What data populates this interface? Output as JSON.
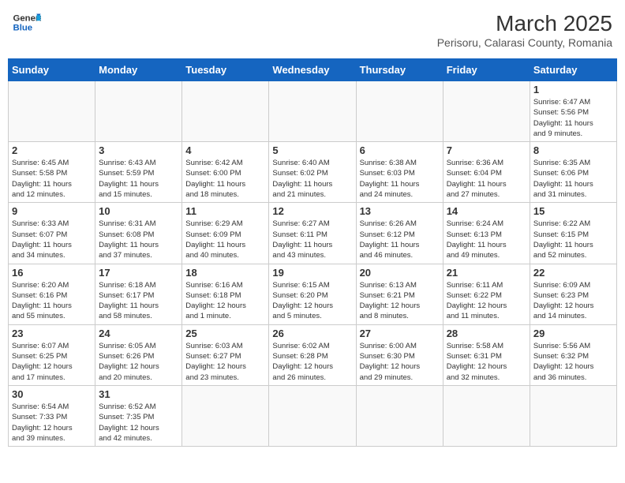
{
  "header": {
    "logo_general": "General",
    "logo_blue": "Blue",
    "month_year": "March 2025",
    "location": "Perisoru, Calarasi County, Romania"
  },
  "weekdays": [
    "Sunday",
    "Monday",
    "Tuesday",
    "Wednesday",
    "Thursday",
    "Friday",
    "Saturday"
  ],
  "weeks": [
    [
      {
        "day": "",
        "info": ""
      },
      {
        "day": "",
        "info": ""
      },
      {
        "day": "",
        "info": ""
      },
      {
        "day": "",
        "info": ""
      },
      {
        "day": "",
        "info": ""
      },
      {
        "day": "",
        "info": ""
      },
      {
        "day": "1",
        "info": "Sunrise: 6:47 AM\nSunset: 5:56 PM\nDaylight: 11 hours\nand 9 minutes."
      }
    ],
    [
      {
        "day": "2",
        "info": "Sunrise: 6:45 AM\nSunset: 5:58 PM\nDaylight: 11 hours\nand 12 minutes."
      },
      {
        "day": "3",
        "info": "Sunrise: 6:43 AM\nSunset: 5:59 PM\nDaylight: 11 hours\nand 15 minutes."
      },
      {
        "day": "4",
        "info": "Sunrise: 6:42 AM\nSunset: 6:00 PM\nDaylight: 11 hours\nand 18 minutes."
      },
      {
        "day": "5",
        "info": "Sunrise: 6:40 AM\nSunset: 6:02 PM\nDaylight: 11 hours\nand 21 minutes."
      },
      {
        "day": "6",
        "info": "Sunrise: 6:38 AM\nSunset: 6:03 PM\nDaylight: 11 hours\nand 24 minutes."
      },
      {
        "day": "7",
        "info": "Sunrise: 6:36 AM\nSunset: 6:04 PM\nDaylight: 11 hours\nand 27 minutes."
      },
      {
        "day": "8",
        "info": "Sunrise: 6:35 AM\nSunset: 6:06 PM\nDaylight: 11 hours\nand 31 minutes."
      }
    ],
    [
      {
        "day": "9",
        "info": "Sunrise: 6:33 AM\nSunset: 6:07 PM\nDaylight: 11 hours\nand 34 minutes."
      },
      {
        "day": "10",
        "info": "Sunrise: 6:31 AM\nSunset: 6:08 PM\nDaylight: 11 hours\nand 37 minutes."
      },
      {
        "day": "11",
        "info": "Sunrise: 6:29 AM\nSunset: 6:09 PM\nDaylight: 11 hours\nand 40 minutes."
      },
      {
        "day": "12",
        "info": "Sunrise: 6:27 AM\nSunset: 6:11 PM\nDaylight: 11 hours\nand 43 minutes."
      },
      {
        "day": "13",
        "info": "Sunrise: 6:26 AM\nSunset: 6:12 PM\nDaylight: 11 hours\nand 46 minutes."
      },
      {
        "day": "14",
        "info": "Sunrise: 6:24 AM\nSunset: 6:13 PM\nDaylight: 11 hours\nand 49 minutes."
      },
      {
        "day": "15",
        "info": "Sunrise: 6:22 AM\nSunset: 6:15 PM\nDaylight: 11 hours\nand 52 minutes."
      }
    ],
    [
      {
        "day": "16",
        "info": "Sunrise: 6:20 AM\nSunset: 6:16 PM\nDaylight: 11 hours\nand 55 minutes."
      },
      {
        "day": "17",
        "info": "Sunrise: 6:18 AM\nSunset: 6:17 PM\nDaylight: 11 hours\nand 58 minutes."
      },
      {
        "day": "18",
        "info": "Sunrise: 6:16 AM\nSunset: 6:18 PM\nDaylight: 12 hours\nand 1 minute."
      },
      {
        "day": "19",
        "info": "Sunrise: 6:15 AM\nSunset: 6:20 PM\nDaylight: 12 hours\nand 5 minutes."
      },
      {
        "day": "20",
        "info": "Sunrise: 6:13 AM\nSunset: 6:21 PM\nDaylight: 12 hours\nand 8 minutes."
      },
      {
        "day": "21",
        "info": "Sunrise: 6:11 AM\nSunset: 6:22 PM\nDaylight: 12 hours\nand 11 minutes."
      },
      {
        "day": "22",
        "info": "Sunrise: 6:09 AM\nSunset: 6:23 PM\nDaylight: 12 hours\nand 14 minutes."
      }
    ],
    [
      {
        "day": "23",
        "info": "Sunrise: 6:07 AM\nSunset: 6:25 PM\nDaylight: 12 hours\nand 17 minutes."
      },
      {
        "day": "24",
        "info": "Sunrise: 6:05 AM\nSunset: 6:26 PM\nDaylight: 12 hours\nand 20 minutes."
      },
      {
        "day": "25",
        "info": "Sunrise: 6:03 AM\nSunset: 6:27 PM\nDaylight: 12 hours\nand 23 minutes."
      },
      {
        "day": "26",
        "info": "Sunrise: 6:02 AM\nSunset: 6:28 PM\nDaylight: 12 hours\nand 26 minutes."
      },
      {
        "day": "27",
        "info": "Sunrise: 6:00 AM\nSunset: 6:30 PM\nDaylight: 12 hours\nand 29 minutes."
      },
      {
        "day": "28",
        "info": "Sunrise: 5:58 AM\nSunset: 6:31 PM\nDaylight: 12 hours\nand 32 minutes."
      },
      {
        "day": "29",
        "info": "Sunrise: 5:56 AM\nSunset: 6:32 PM\nDaylight: 12 hours\nand 36 minutes."
      }
    ],
    [
      {
        "day": "30",
        "info": "Sunrise: 6:54 AM\nSunset: 7:33 PM\nDaylight: 12 hours\nand 39 minutes."
      },
      {
        "day": "31",
        "info": "Sunrise: 6:52 AM\nSunset: 7:35 PM\nDaylight: 12 hours\nand 42 minutes."
      },
      {
        "day": "",
        "info": ""
      },
      {
        "day": "",
        "info": ""
      },
      {
        "day": "",
        "info": ""
      },
      {
        "day": "",
        "info": ""
      },
      {
        "day": "",
        "info": ""
      }
    ]
  ]
}
